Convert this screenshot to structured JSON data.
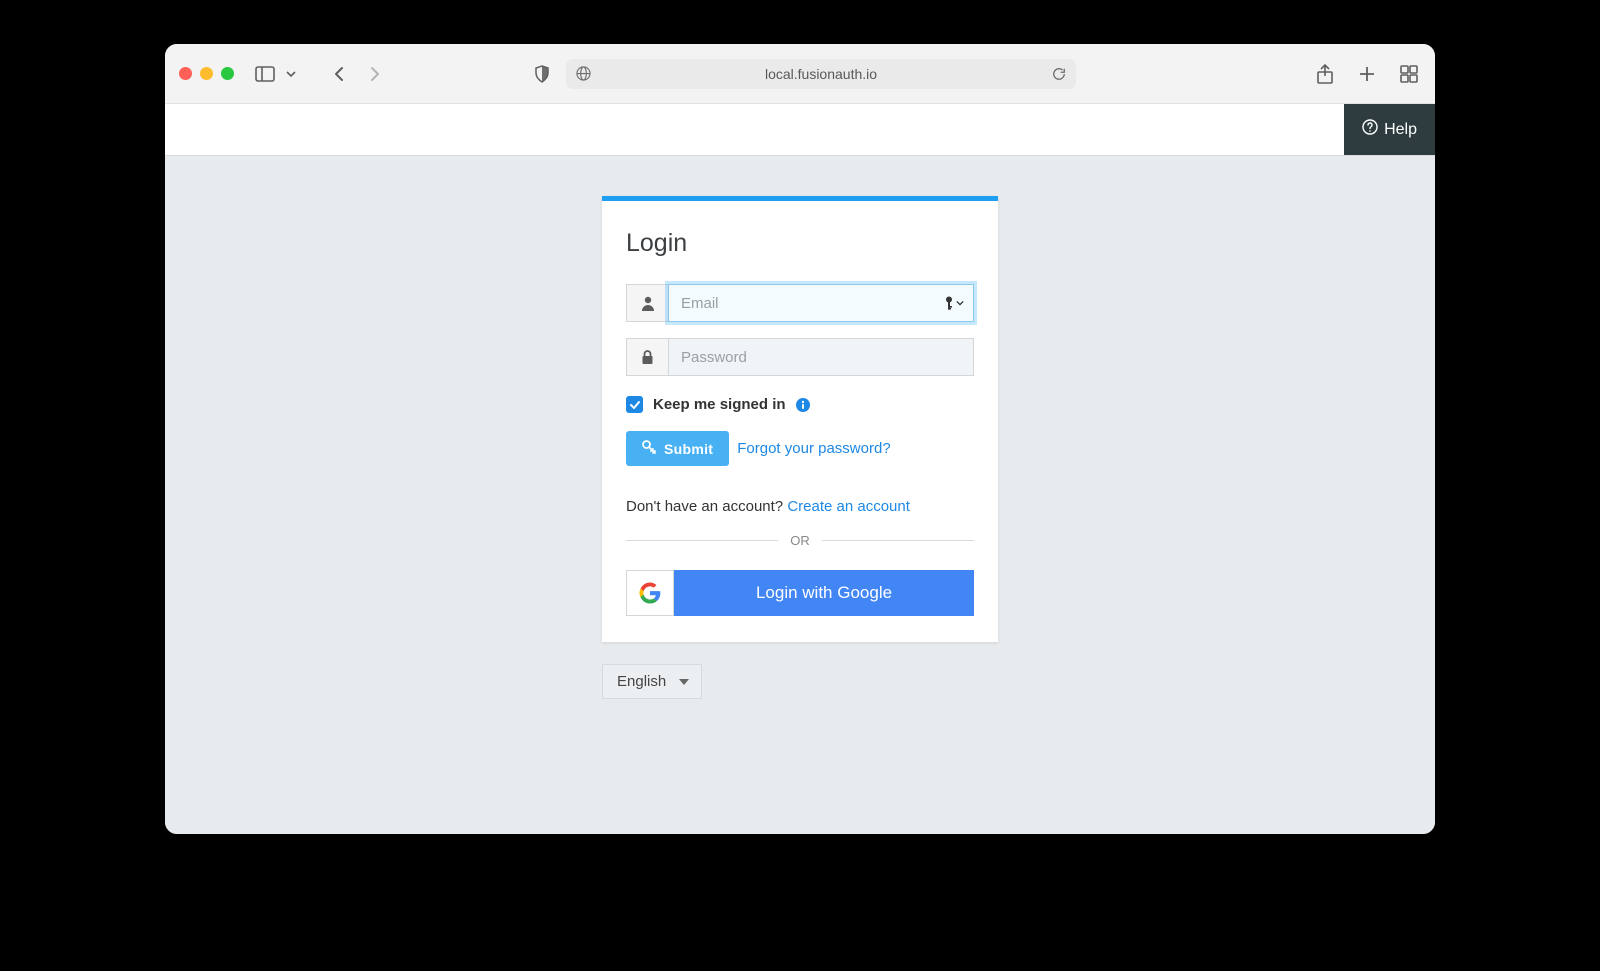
{
  "browser": {
    "url": "local.fusionauth.io"
  },
  "header": {
    "help_label": "Help"
  },
  "login": {
    "title": "Login",
    "email_placeholder": "Email",
    "password_placeholder": "Password",
    "keep_signed_in_label": "Keep me signed in",
    "submit_label": "Submit",
    "forgot_label": "Forgot your password?",
    "no_account_text": "Don't have an account? ",
    "create_account_label": "Create an account",
    "divider_label": "OR",
    "google_label": "Login with Google"
  },
  "locale": {
    "selected": "English"
  }
}
